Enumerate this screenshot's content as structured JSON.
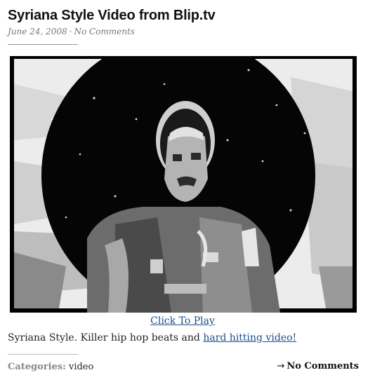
{
  "post": {
    "title": "Syriana Style Video from Blip.tv",
    "date": "June 24, 2008",
    "separator": "·",
    "comments_meta": "No Comments"
  },
  "video": {
    "click_label": "Click To Play"
  },
  "body": {
    "text": "Syriana Style. Killer hip hop beats and",
    "link_text": "hard hitting video!"
  },
  "footer": {
    "categories_label": "Categories:",
    "category_value": "video",
    "comments_arrow": "→",
    "comments_label": "No Comments"
  }
}
